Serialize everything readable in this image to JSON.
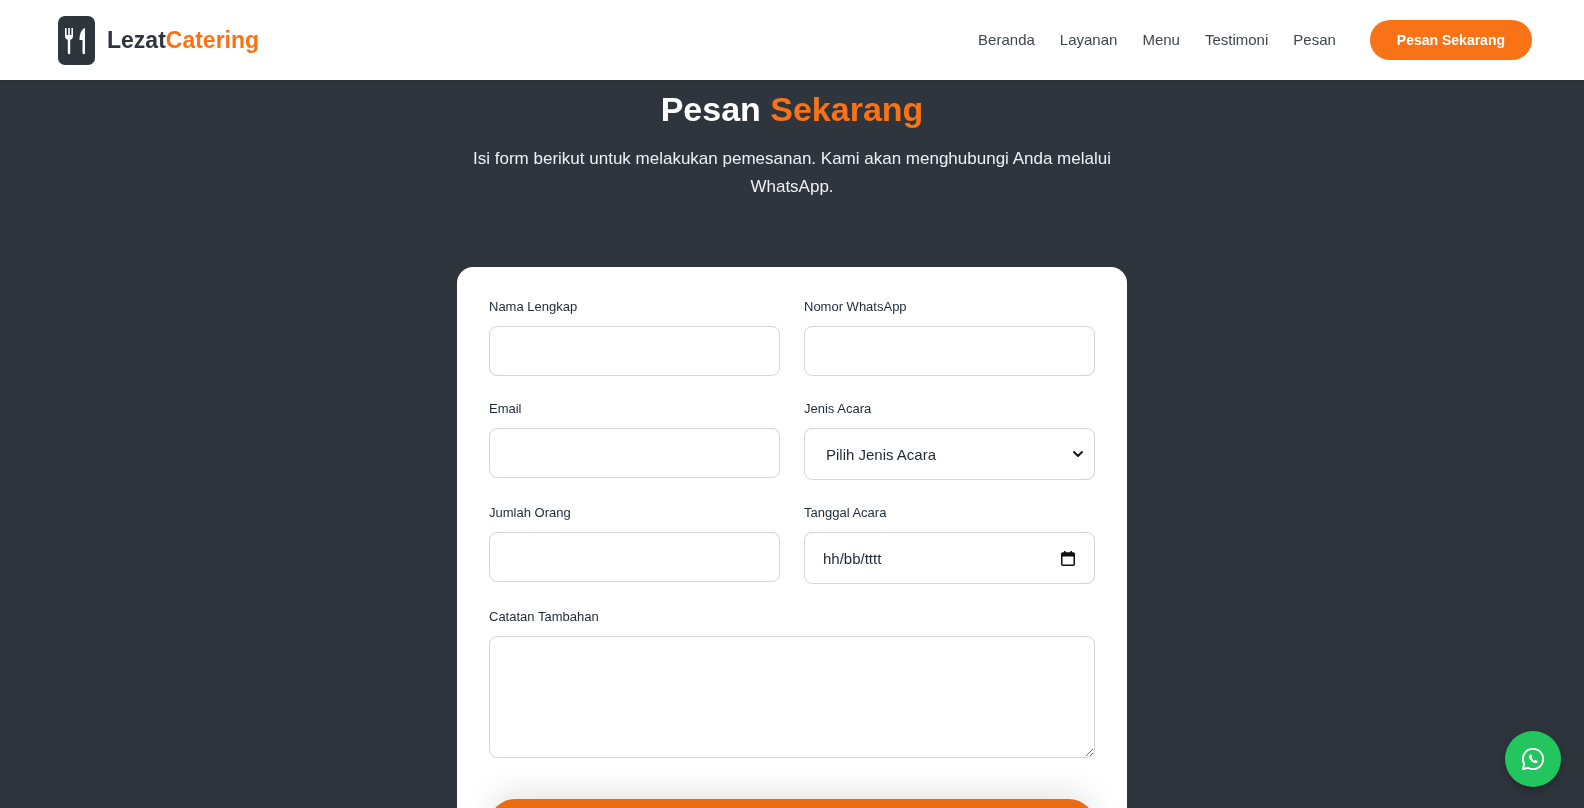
{
  "header": {
    "brand": [
      {
        "text": "Lezat",
        "highlight": false
      },
      {
        "text": "Catering",
        "highlight": true
      }
    ],
    "nav": [
      "Beranda",
      "Layanan",
      "Menu",
      "Testimoni",
      "Pesan"
    ],
    "cta": "Pesan Sekarang"
  },
  "order": {
    "title": [
      {
        "text": "Pesan",
        "highlight": false
      },
      {
        "text": "Sekarang",
        "highlight": true
      }
    ],
    "subtitle": "Isi form berikut untuk melakukan pemesanan. Kami akan menghubungi Anda melalui WhatsApp.",
    "fields": [
      {
        "label": "Nama Lengkap",
        "kind": "text"
      },
      {
        "label": "Nomor WhatsApp",
        "kind": "text"
      },
      {
        "label": "Email",
        "kind": "text"
      },
      {
        "label": "Jenis Acara",
        "kind": "select",
        "value": "Pilih Jenis Acara"
      },
      {
        "label": "Jumlah Orang",
        "kind": "text"
      },
      {
        "label": "Tanggal Acara",
        "kind": "date",
        "placeholder": "hh/bb/tttt"
      },
      {
        "label": "Catatan Tambahan",
        "kind": "textarea"
      }
    ]
  }
}
